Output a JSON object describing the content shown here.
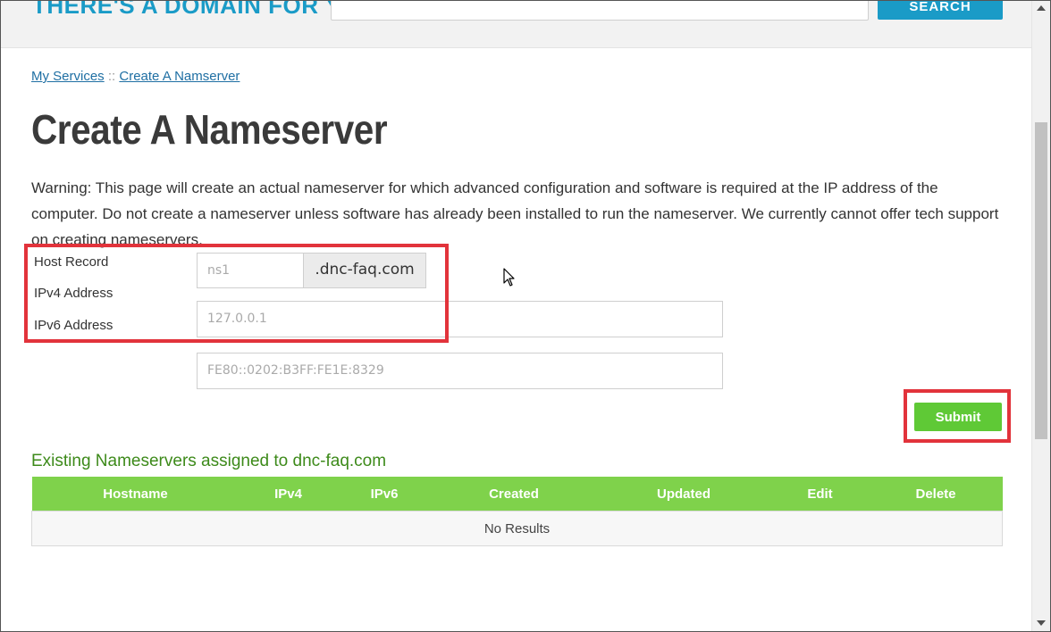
{
  "banner": {
    "title": "THERE'S A DOMAIN FOR YOU.",
    "search_button": "SEARCH"
  },
  "breadcrumb": {
    "items": [
      "My Services",
      "Create A Namserver"
    ],
    "separator": "::"
  },
  "page_title": "Create A Nameserver",
  "warning": "Warning: This page will create an actual nameserver for which advanced configuration and software is required at the IP address of the computer. Do not create a nameserver unless software has already been installed to run the nameserver. We currently cannot offer tech support on creating nameservers.",
  "form": {
    "labels": {
      "host_record": "Host Record",
      "ipv4": "IPv4 Address",
      "ipv6": "IPv6 Address"
    },
    "host_record_placeholder": "ns1",
    "domain_suffix": ".dnc-faq.com",
    "ipv4_placeholder": "127.0.0.1",
    "ipv6_placeholder": "FE80::0202:B3FF:FE1E:8329",
    "submit_label": "Submit"
  },
  "existing": {
    "heading": "Existing Nameservers assigned to dnc-faq.com",
    "columns": [
      "Hostname",
      "IPv4",
      "IPv6",
      "Created",
      "Updated",
      "Edit",
      "Delete"
    ],
    "empty_text": "No Results"
  },
  "colors": {
    "brand_blue": "#1a9bc7",
    "accent_green": "#5fc936",
    "table_header_green": "#7fd24b",
    "heading_green": "#3d8a1a",
    "highlight_red": "#e2333b",
    "link_blue": "#1f6fa3"
  },
  "icons": {
    "cursor": "mouse-pointer-icon"
  }
}
